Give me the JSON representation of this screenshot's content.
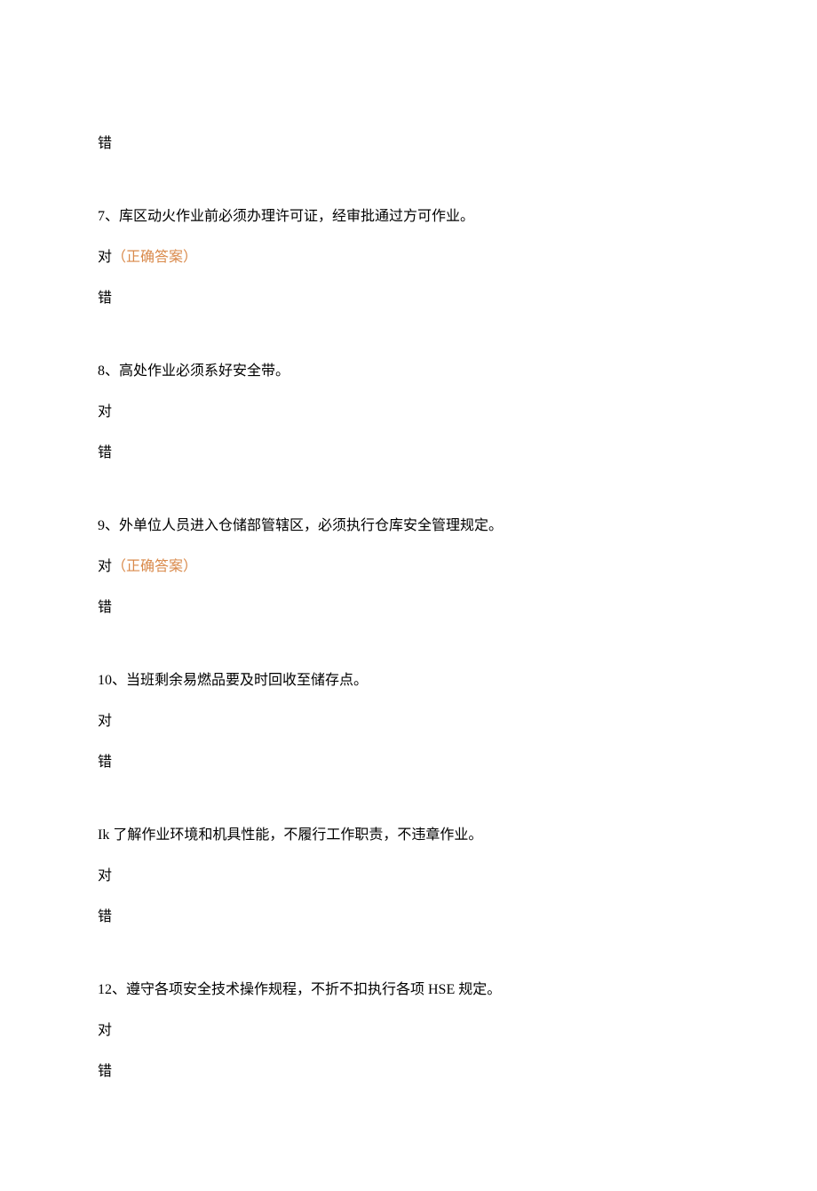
{
  "correct_label": "（正确答案）",
  "options": {
    "true": "对",
    "false": "错"
  },
  "questions": [
    {
      "stem_lines": [
        "错"
      ],
      "trailing": true
    },
    {
      "stem_lines": [
        "7、库区动火作业前必须办理许可证，经审批通过方可作业。"
      ],
      "correct_on_true": true
    },
    {
      "stem_lines": [
        "8、高处作业必须系好安全带。"
      ]
    },
    {
      "stem_lines": [
        "9、外单位人员进入仓储部管辖区，必须执行仓库安全管理规定。"
      ],
      "correct_on_true": true
    },
    {
      "stem_lines": [
        "10、当班剩余易燃品要及时回收至储存点。"
      ]
    },
    {
      "stem_lines": [
        "Ik 了解作业环境和机具性能，不履行工作职责，不违章作业。"
      ]
    },
    {
      "stem_lines": [
        "12、遵守各项安全技术操作规程，不折不扣执行各项 HSE 规定。"
      ]
    }
  ]
}
